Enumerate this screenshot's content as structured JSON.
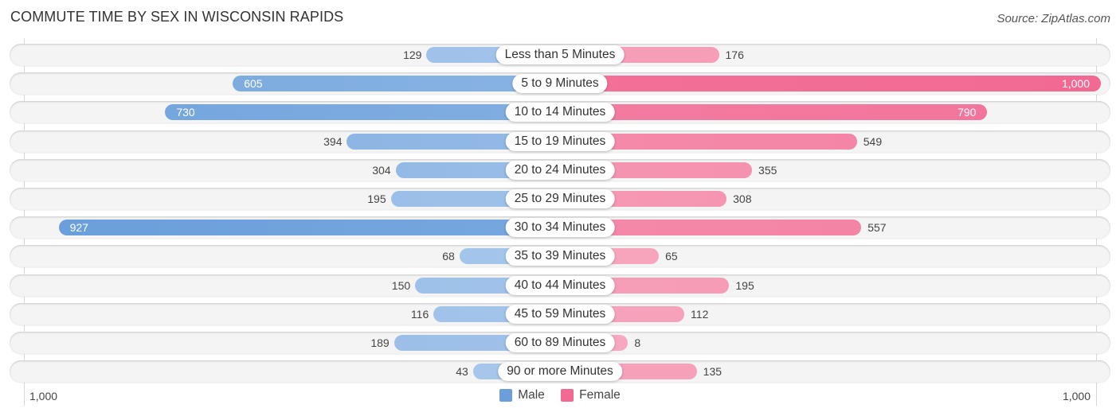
{
  "title": "COMMUTE TIME BY SEX IN WISCONSIN RAPIDS",
  "source": "Source: ZipAtlas.com",
  "colors": {
    "male_dark": "#6a9fdb",
    "male_light": "#a9c8ec",
    "female_dark": "#f26a94",
    "female_light": "#f7a9c0"
  },
  "legend": [
    {
      "label": "Male",
      "color": "#6a9fdb"
    },
    {
      "label": "Female",
      "color": "#f26a94"
    }
  ],
  "axis": {
    "left_label": "1,000",
    "right_label": "1,000"
  },
  "chart_data": {
    "type": "bar",
    "orientation": "horizontal-diverging",
    "title": "COMMUTE TIME BY SEX IN WISCONSIN RAPIDS",
    "xlabel": "",
    "ylabel": "",
    "xlim": [
      -1000,
      1000
    ],
    "legend_position": "bottom-center",
    "categories": [
      "Less than 5 Minutes",
      "5 to 9 Minutes",
      "10 to 14 Minutes",
      "15 to 19 Minutes",
      "20 to 24 Minutes",
      "25 to 29 Minutes",
      "30 to 34 Minutes",
      "35 to 39 Minutes",
      "40 to 44 Minutes",
      "45 to 59 Minutes",
      "60 to 89 Minutes",
      "90 or more Minutes"
    ],
    "series": [
      {
        "name": "Male",
        "values": [
          129,
          605,
          730,
          394,
          304,
          195,
          927,
          68,
          150,
          116,
          189,
          43
        ],
        "labels": [
          "129",
          "605",
          "730",
          "394",
          "304",
          "195",
          "927",
          "68",
          "150",
          "116",
          "189",
          "43"
        ]
      },
      {
        "name": "Female",
        "values": [
          176,
          1000,
          790,
          549,
          355,
          308,
          557,
          65,
          195,
          112,
          8,
          135
        ],
        "labels": [
          "176",
          "1,000",
          "790",
          "549",
          "355",
          "308",
          "557",
          "65",
          "195",
          "112",
          "8",
          "135"
        ]
      }
    ]
  }
}
